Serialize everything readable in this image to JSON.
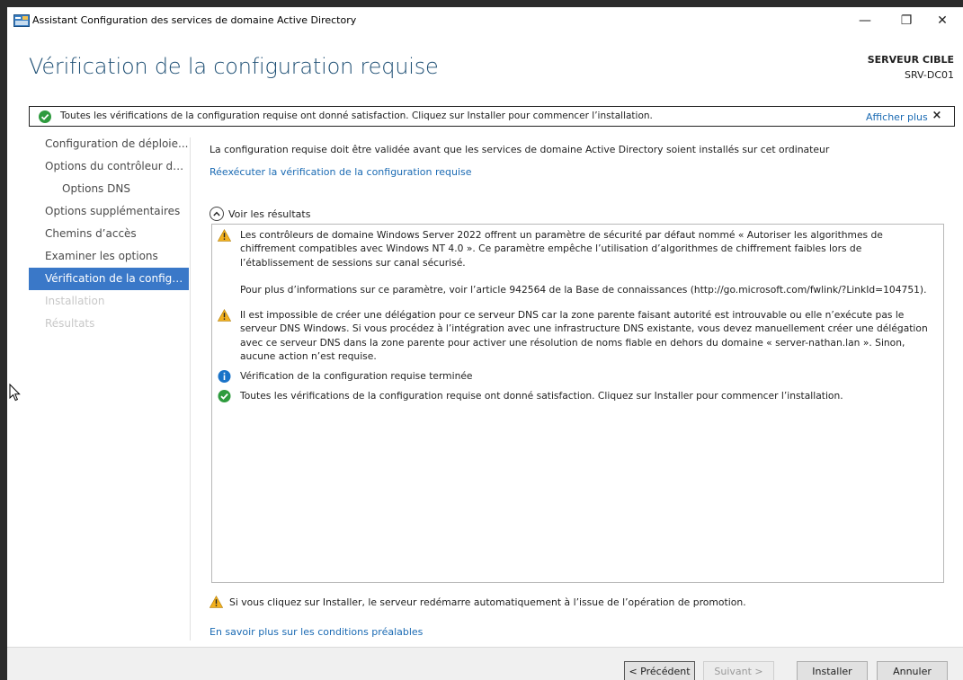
{
  "window": {
    "title": "Assistant Configuration des services de domaine Active Directory",
    "controls": {
      "minimize": "—",
      "maximize": "❐",
      "close": "✕"
    }
  },
  "header": {
    "page_title": "Vérification de la configuration requise",
    "target_label": "SERVEUR CIBLE",
    "target_server": "SRV-DC01"
  },
  "banner": {
    "icon": "check-circle-icon",
    "text": "Toutes les vérifications de la configuration requise ont donné satisfaction. Cliquez sur Installer pour commencer l’installation.",
    "more_link": "Afficher plus",
    "close": "×"
  },
  "sidebar": {
    "items": [
      {
        "label": "Configuration de déploie...",
        "state": "normal"
      },
      {
        "label": "Options du contrôleur de...",
        "state": "normal"
      },
      {
        "label": "Options DNS",
        "state": "sub"
      },
      {
        "label": "Options supplémentaires",
        "state": "normal"
      },
      {
        "label": "Chemins d’accès",
        "state": "normal"
      },
      {
        "label": "Examiner les options",
        "state": "normal"
      },
      {
        "label": "Vérification de la configur...",
        "state": "active"
      },
      {
        "label": "Installation",
        "state": "disabled"
      },
      {
        "label": "Résultats",
        "state": "disabled"
      }
    ]
  },
  "main": {
    "intro": "La configuration requise doit être validée avant que les services de domaine Active Directory soient installés sur cet ordinateur",
    "rerun_link": "Réexécuter la vérification de la configuration requise",
    "results_toggle": "Voir les résultats",
    "results": [
      {
        "icon": "warning-icon",
        "text": "Les contrôleurs de domaine Windows Server 2022 offrent un paramètre de sécurité par défaut nommé « Autoriser les algorithmes de chiffrement compatibles avec Windows NT 4.0 ». Ce paramètre empêche l’utilisation d’algorithmes de chiffrement faibles lors de l’établissement de sessions sur canal sécurisé.",
        "text2": "Pour plus d’informations sur ce paramètre, voir l’article 942564 de la Base de connaissances (http://go.microsoft.com/fwlink/?LinkId=104751)."
      },
      {
        "icon": "warning-icon",
        "text": "Il est impossible de créer une délégation pour ce serveur DNS car la zone parente faisant autorité est introuvable ou elle n’exécute pas le serveur DNS Windows. Si vous procédez à l’intégration avec une infrastructure DNS existante, vous devez manuellement créer une délégation avec ce serveur DNS dans la zone parente pour activer une résolution de noms fiable en dehors du domaine « server-nathan.lan ». Sinon, aucune action n’est requise."
      },
      {
        "icon": "info-icon",
        "text": "Vérification de la configuration requise terminée"
      },
      {
        "icon": "check-circle-icon",
        "text": "Toutes les vérifications de la configuration requise ont donné satisfaction. Cliquez sur Installer pour commencer l’installation."
      }
    ],
    "restart_note": "Si vous cliquez sur Installer, le serveur redémarre automatiquement à l’issue de l’opération de promotion.",
    "learn_more_link": "En savoir plus sur les conditions préalables"
  },
  "footer": {
    "previous": "< Précédent",
    "next": "Suivant >",
    "install": "Installer",
    "cancel": "Annuler"
  },
  "colors": {
    "accent": "#3a78c8",
    "link": "#1a6ab3",
    "title": "#1e4f74",
    "warning": "#f2b01e",
    "success": "#2e9b3e",
    "info": "#1a73c8"
  }
}
